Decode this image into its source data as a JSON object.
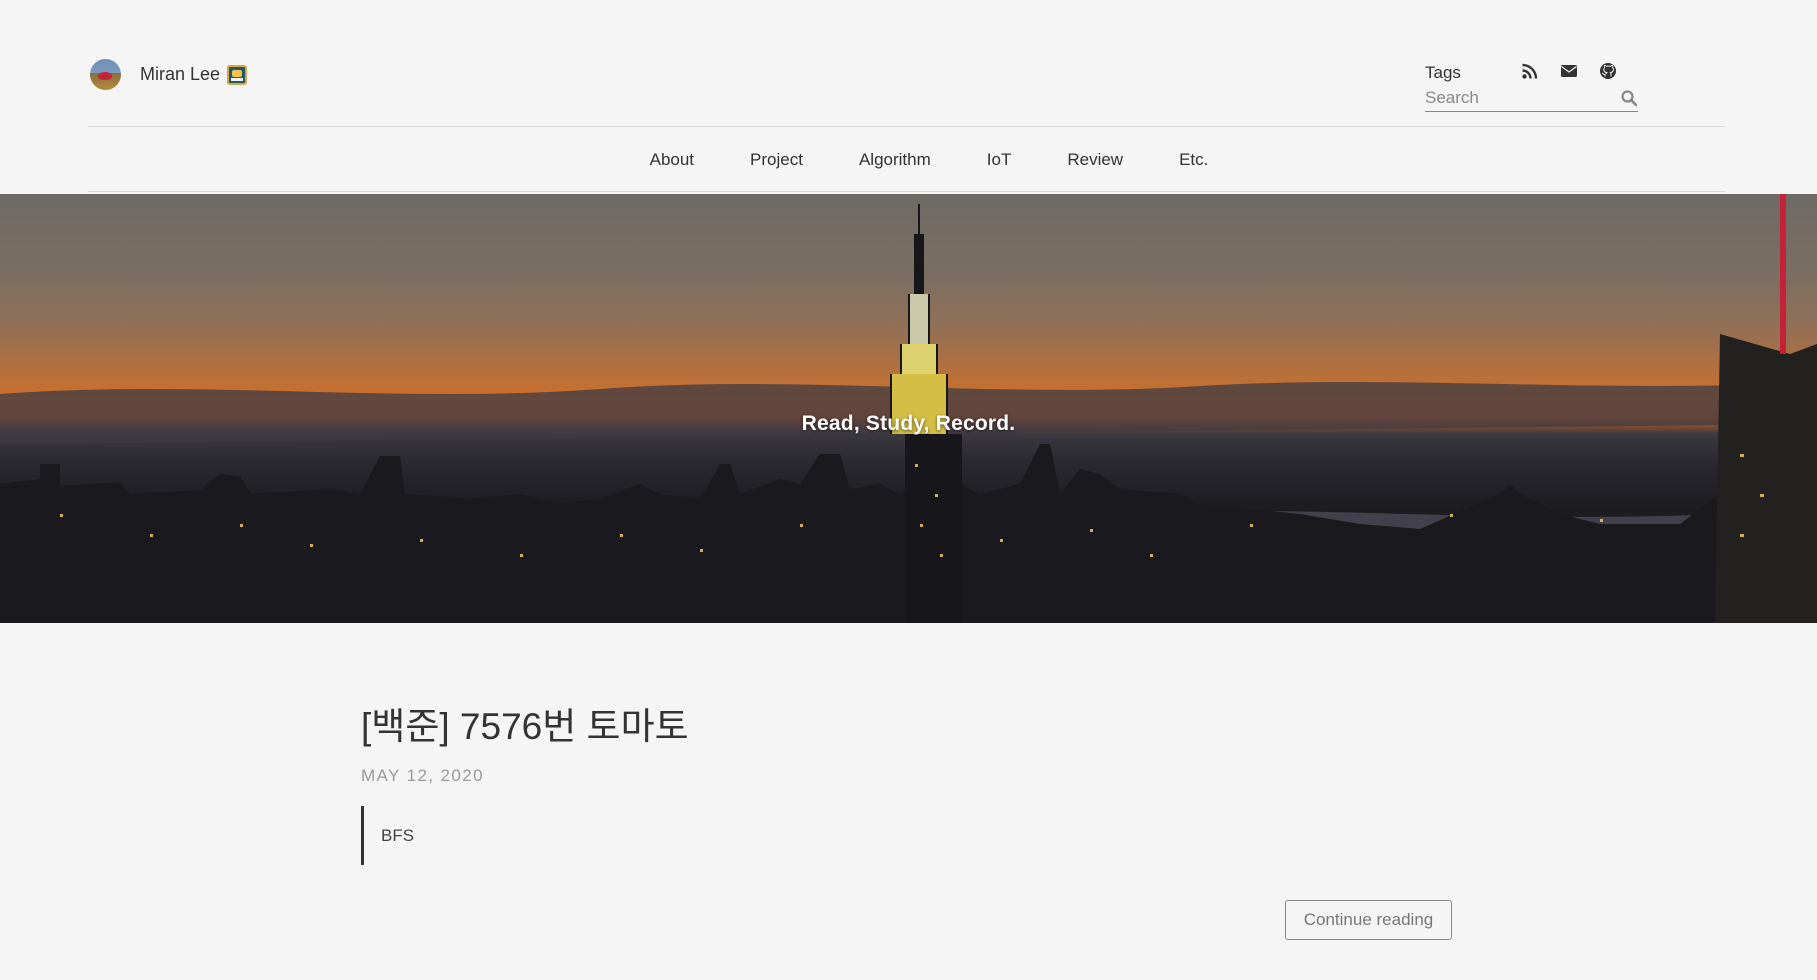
{
  "header": {
    "brand": {
      "name": "Miran Lee",
      "avatar_icon": "avatar-photo",
      "emoji_icon": "laptop-emoji-icon"
    },
    "tags_label": "Tags",
    "search": {
      "placeholder": "Search",
      "value": ""
    },
    "social_icons": [
      "rss-icon",
      "envelope-icon",
      "github-icon"
    ]
  },
  "nav": {
    "items": [
      {
        "label": "About"
      },
      {
        "label": "Project"
      },
      {
        "label": "Algorithm"
      },
      {
        "label": "IoT"
      },
      {
        "label": "Review"
      },
      {
        "label": "Etc."
      }
    ]
  },
  "hero": {
    "tagline": "Read, Study, Record."
  },
  "post": {
    "title": "[백준] 7576번 토마토",
    "date": "MAY 12, 2020",
    "excerpt": "BFS",
    "continue_label": "Continue reading"
  }
}
